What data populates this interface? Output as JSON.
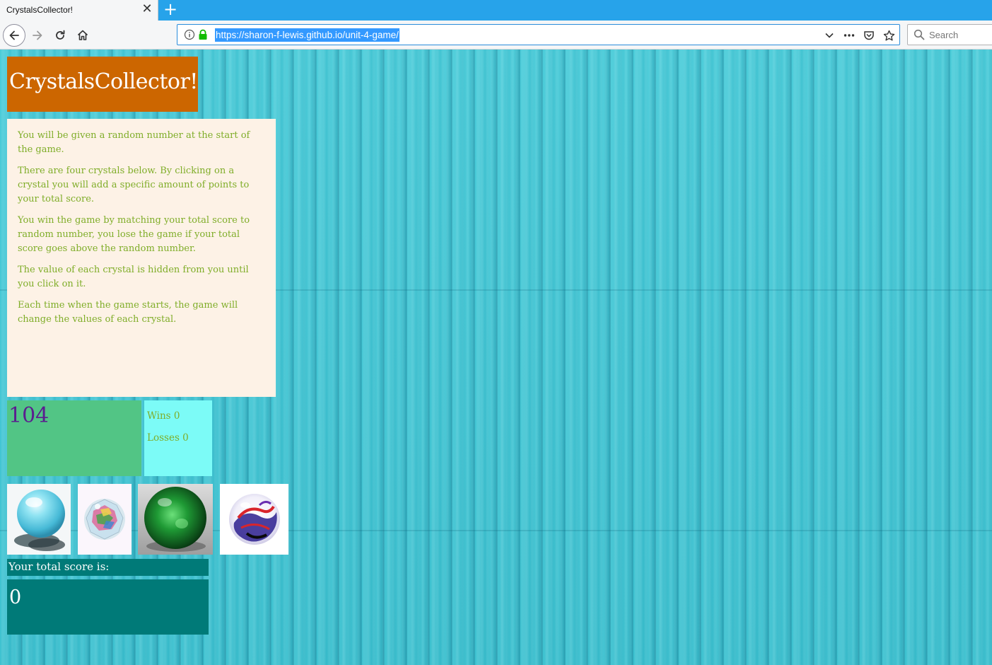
{
  "browser": {
    "tab_title": "CrystalsCollector!",
    "tab_close_glyph": "✕",
    "new_tab_glyph": "+",
    "url": "https://sharon-f-lewis.github.io/unit-4-game/",
    "search_placeholder": "Search"
  },
  "game": {
    "title": "CrystalsCollector!",
    "instructions": [
      "You will be given a random number at the start of the game.",
      "There are four crystals below. By clicking on a crystal you will add a specific amount of points to your total score.",
      "You win the game by matching your total score to random number, you lose the game if your total score goes above the random number.",
      "The value of each crystal is hidden from you until you click on it.",
      "Each time when the game starts, the game will change the values of each crystal."
    ],
    "target_number": "104",
    "wins_label": "Wins 0",
    "losses_label": "Losses 0",
    "score_label": "Your total score is:",
    "score_value": "0",
    "crystals": [
      {
        "name": "aqua-crystal"
      },
      {
        "name": "faceted-crystal"
      },
      {
        "name": "green-crystal"
      },
      {
        "name": "swirl-crystal"
      }
    ]
  },
  "colors": {
    "title_bg": "#cc6600",
    "instructions_bg": "#fdf2e6",
    "instructions_text": "#7fad28",
    "target_bg": "#52c585",
    "target_text": "#5b1e8f",
    "stats_bg": "#7cfbf7",
    "score_bg": "#007a78",
    "page_bg": "#3cc8d6",
    "tabbar_bg": "#27a3ea"
  }
}
